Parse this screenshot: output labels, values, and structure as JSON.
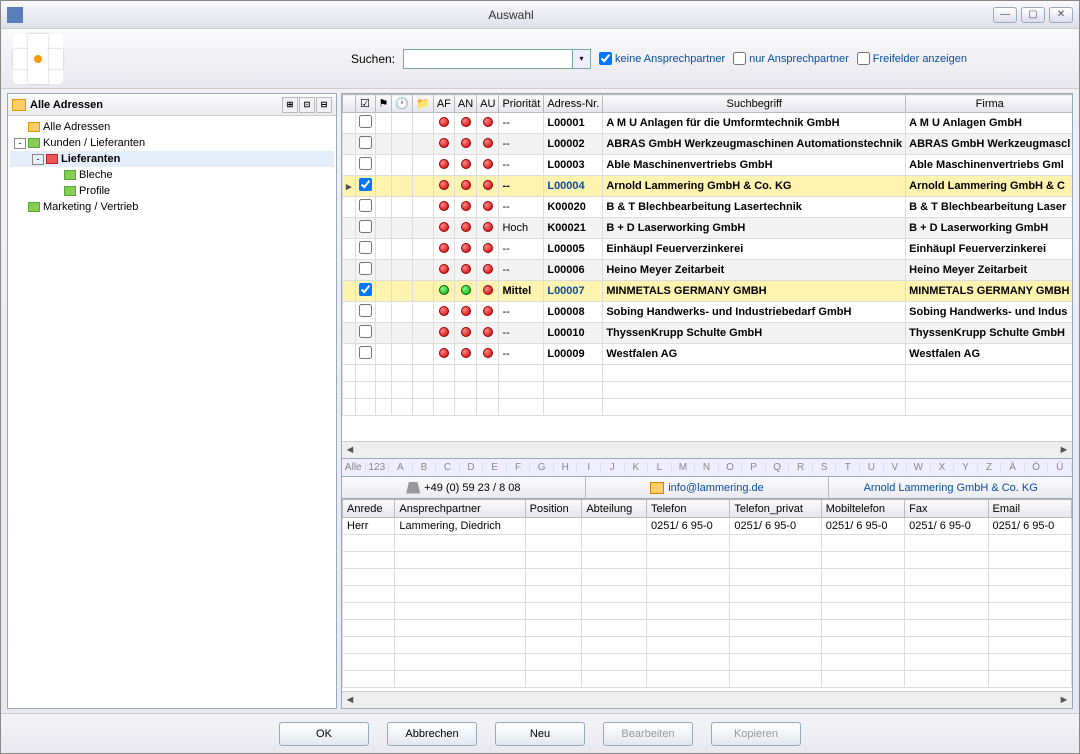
{
  "window": {
    "title": "Auswahl"
  },
  "search": {
    "label": "Suchen:",
    "value": "",
    "chk_keine": "keine Ansprechpartner",
    "chk_nur": "nur Ansprechpartner",
    "chk_frei": "Freifelder anzeigen",
    "chk_keine_checked": true,
    "chk_nur_checked": false,
    "chk_frei_checked": false
  },
  "tree": {
    "header": "Alle Adressen",
    "items": [
      {
        "indent": 0,
        "toggle": "",
        "icon": "y",
        "label": "Alle Adressen",
        "selected": false
      },
      {
        "indent": 0,
        "toggle": "-",
        "icon": "g",
        "label": "Kunden / Lieferanten",
        "selected": false
      },
      {
        "indent": 1,
        "toggle": "-",
        "icon": "r",
        "label": "Lieferanten",
        "selected": true
      },
      {
        "indent": 2,
        "toggle": "",
        "icon": "g",
        "label": "Bleche",
        "selected": false
      },
      {
        "indent": 2,
        "toggle": "",
        "icon": "g",
        "label": "Profile",
        "selected": false
      },
      {
        "indent": 0,
        "toggle": "",
        "icon": "g",
        "label": "Marketing / Vertrieb",
        "selected": false
      }
    ]
  },
  "grid": {
    "headers": [
      "",
      "☑",
      "⚑",
      "🕐",
      "📁",
      "AF",
      "AN",
      "AU",
      "Priorität",
      "Adress-Nr.",
      "Suchbegriff",
      "Firma"
    ],
    "rows": [
      {
        "marker": "",
        "chk": false,
        "af": "red",
        "an": "red",
        "au": "red",
        "prio": "--",
        "nr": "L00001",
        "such": "A M U Anlagen für die Umformtechnik GmbH",
        "firma": "A M U Anlagen GmbH",
        "alt": false,
        "hl": false
      },
      {
        "marker": "",
        "chk": false,
        "af": "red",
        "an": "red",
        "au": "red",
        "prio": "--",
        "nr": "L00002",
        "such": "ABRAS GmbH Werkzeugmaschinen Automationstechnik",
        "firma": "ABRAS GmbH Werkzeugmascl",
        "alt": true,
        "hl": false
      },
      {
        "marker": "",
        "chk": false,
        "af": "red",
        "an": "red",
        "au": "red",
        "prio": "--",
        "nr": "L00003",
        "such": "Able Maschinenvertriebs GmbH",
        "firma": "Able Maschinenvertriebs Gml",
        "alt": false,
        "hl": false
      },
      {
        "marker": "▸",
        "chk": true,
        "af": "red",
        "an": "red",
        "au": "red",
        "prio": "--",
        "nr": "L00004",
        "such": "Arnold Lammering GmbH & Co. KG",
        "firma": "Arnold Lammering GmbH & C",
        "alt": false,
        "hl": true
      },
      {
        "marker": "",
        "chk": false,
        "af": "red",
        "an": "red",
        "au": "red",
        "prio": "--",
        "nr": "K00020",
        "such": "B & T Blechbearbeitung Lasertechnik",
        "firma": "B & T Blechbearbeitung Laser",
        "alt": false,
        "hl": false
      },
      {
        "marker": "",
        "chk": false,
        "af": "red",
        "an": "red",
        "au": "red",
        "prio": "Hoch",
        "nr": "K00021",
        "such": "B + D Laserworking GmbH",
        "firma": "B + D Laserworking GmbH",
        "alt": true,
        "hl": false
      },
      {
        "marker": "",
        "chk": false,
        "af": "red",
        "an": "red",
        "au": "red",
        "prio": "--",
        "nr": "L00005",
        "such": "Einhäupl Feuerverzinkerei",
        "firma": "Einhäupl Feuerverzinkerei",
        "alt": false,
        "hl": false
      },
      {
        "marker": "",
        "chk": false,
        "af": "red",
        "an": "red",
        "au": "red",
        "prio": "--",
        "nr": "L00006",
        "such": "Heino Meyer Zeitarbeit",
        "firma": "Heino Meyer Zeitarbeit",
        "alt": true,
        "hl": false
      },
      {
        "marker": "",
        "chk": true,
        "af": "green",
        "an": "green",
        "au": "red",
        "prio": "Mittel",
        "nr": "L00007",
        "such": "MINMETALS GERMANY GMBH",
        "firma": "MINMETALS GERMANY GMBH",
        "alt": false,
        "hl": true
      },
      {
        "marker": "",
        "chk": false,
        "af": "red",
        "an": "red",
        "au": "red",
        "prio": "--",
        "nr": "L00008",
        "such": "Sobing Handwerks- und Industriebedarf GmbH",
        "firma": "Sobing Handwerks- und Indus",
        "alt": false,
        "hl": false
      },
      {
        "marker": "",
        "chk": false,
        "af": "red",
        "an": "red",
        "au": "red",
        "prio": "--",
        "nr": "L00010",
        "such": "ThyssenKrupp Schulte GmbH",
        "firma": "ThyssenKrupp Schulte GmbH",
        "alt": true,
        "hl": false
      },
      {
        "marker": "",
        "chk": false,
        "af": "red",
        "an": "red",
        "au": "red",
        "prio": "--",
        "nr": "L00009",
        "such": "Westfalen AG",
        "firma": "Westfalen AG",
        "alt": false,
        "hl": false
      }
    ]
  },
  "alpha": [
    "Alle",
    "123",
    "A",
    "B",
    "C",
    "D",
    "E",
    "F",
    "G",
    "H",
    "I",
    "J",
    "K",
    "L",
    "M",
    "N",
    "O",
    "P",
    "Q",
    "R",
    "S",
    "T",
    "U",
    "V",
    "W",
    "X",
    "Y",
    "Z",
    "Ä",
    "Ö",
    "Ü"
  ],
  "info": {
    "phone": "+49 (0) 59 23 / 8 08",
    "email": "info@lammering.de",
    "company": "Arnold Lammering GmbH & Co. KG"
  },
  "contacts": {
    "headers": [
      "Anrede",
      "Ansprechpartner",
      "Position",
      "Abteilung",
      "Telefon",
      "Telefon_privat",
      "Mobiltelefon",
      "Fax",
      "Email"
    ],
    "rows": [
      {
        "anrede": "Herr",
        "name": "Lammering, Diedrich",
        "position": "",
        "abteilung": "",
        "telefon": "0251/ 6 95-0",
        "telefon_privat": "0251/ 6 95-0",
        "mobil": "0251/ 6 95-0",
        "fax": "0251/ 6 95-0",
        "email": "0251/ 6 95-0"
      }
    ]
  },
  "buttons": {
    "ok": "OK",
    "abbrechen": "Abbrechen",
    "neu": "Neu",
    "bearbeiten": "Bearbeiten",
    "kopieren": "Kopieren"
  }
}
